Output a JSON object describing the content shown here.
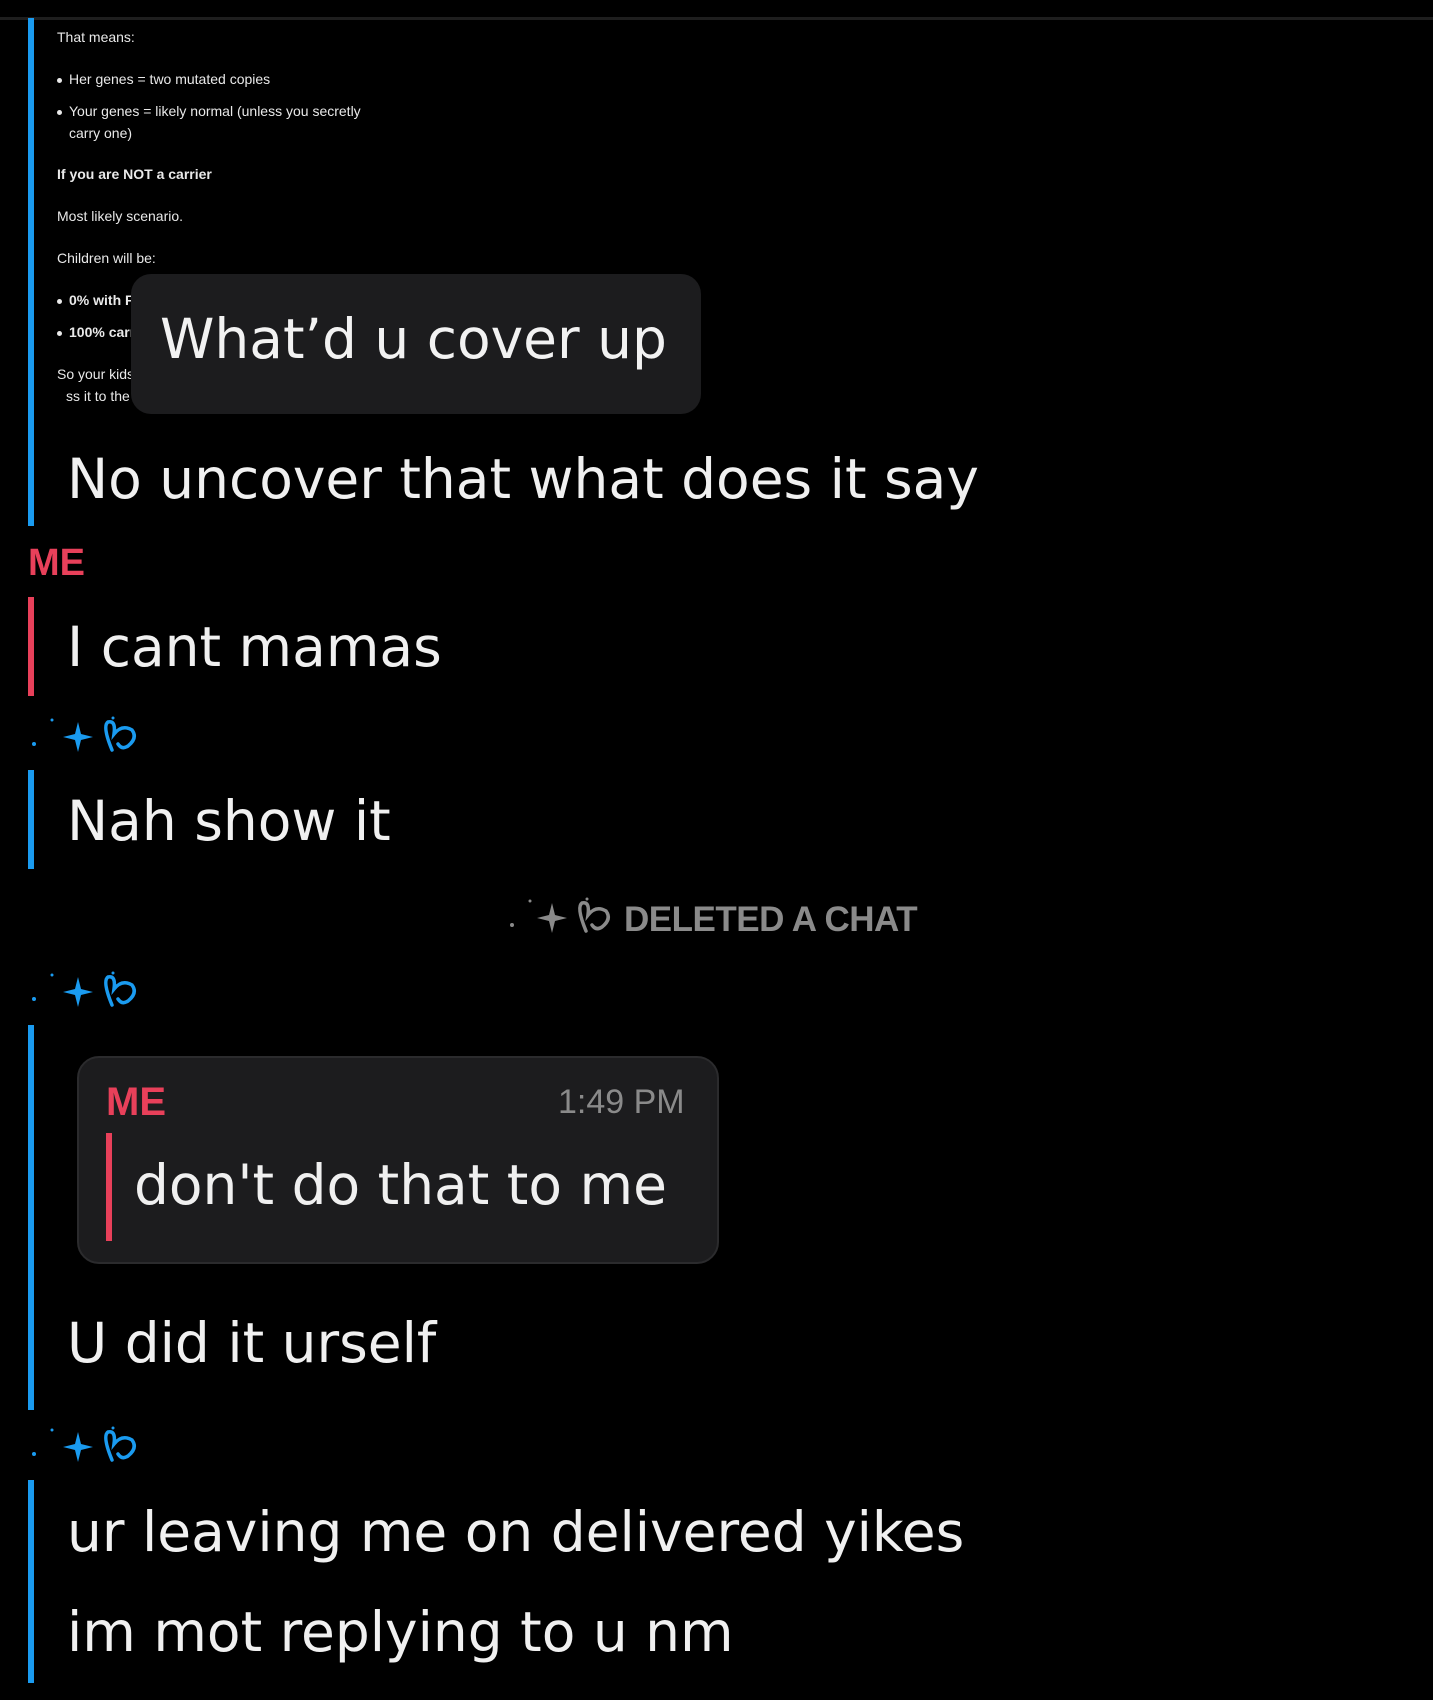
{
  "shared_screenshot": {
    "lines": [
      "That means:",
      "Her genes = two mutated copies",
      "Your genes = likely normal (unless you secretly",
      "carry one)",
      "If you are NOT a carrier",
      "Most likely scenario.",
      "Children will be:",
      "0% with FI",
      "100% carr",
      "So your kids",
      "ss it to the"
    ]
  },
  "overlay_caption": "What’d u cover up",
  "messages": [
    {
      "sender": "",
      "text": "No uncover that what does it say"
    },
    {
      "sender": "ME",
      "text": "I cant mamas"
    },
    {
      "sender": "",
      "text": "Nah show it"
    },
    {
      "sender": "",
      "text": "U did it urself"
    },
    {
      "sender": "",
      "text": "ur leaving me on delivered yikes"
    },
    {
      "sender": "",
      "text": "im mot replying to u nm"
    }
  ],
  "system_notice": "DELETED A CHAT",
  "quoted_reply": {
    "sender": "ME",
    "time": "1:49 PM",
    "text": "don't do that to me"
  },
  "colors": {
    "background": "#000000",
    "friend_accent": "#1a9bf0",
    "me_accent": "#e8405a",
    "bubble": "#1c1c1e",
    "muted": "#8a8a8a"
  },
  "icons": [
    "sparkle-icon",
    "heart-swirl-icon"
  ]
}
